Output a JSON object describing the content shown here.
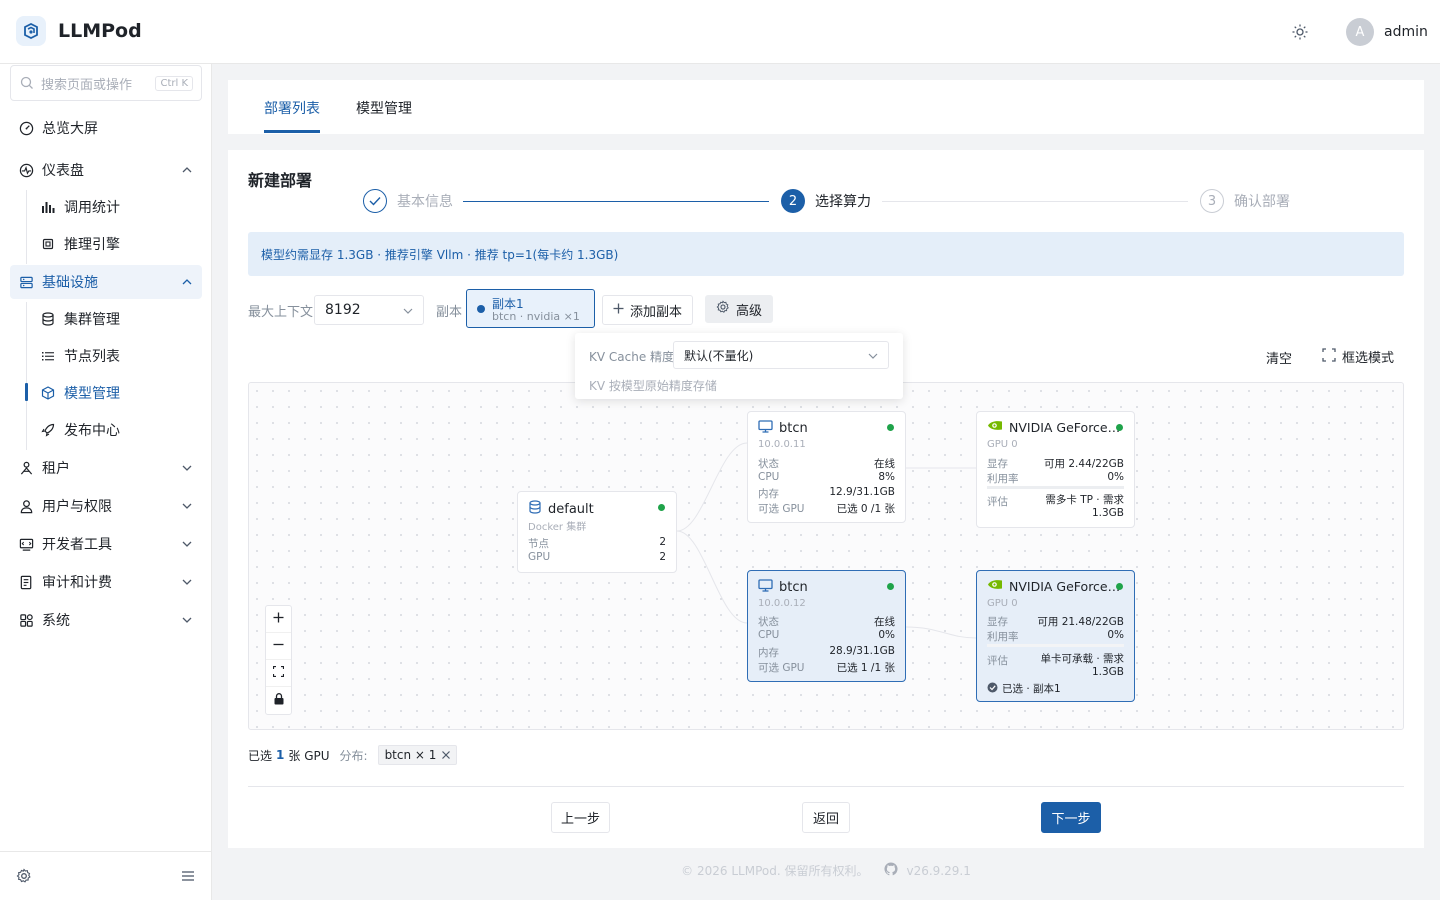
{
  "app": {
    "name": "LLMPod"
  },
  "user": {
    "avatar_letter": "A",
    "name": "admin"
  },
  "search": {
    "placeholder": "搜索页面或操作",
    "shortcut": "Ctrl K"
  },
  "sidebar": {
    "items": [
      {
        "label": "总览大屏",
        "icon": "dashboard-gauge-icon"
      },
      {
        "label": "仪表盘",
        "icon": "activity-icon",
        "expanded": true,
        "children": [
          {
            "label": "调用统计",
            "icon": "bar-chart-icon"
          },
          {
            "label": "推理引擎",
            "icon": "chip-icon"
          }
        ]
      },
      {
        "label": "基础设施",
        "icon": "server-icon",
        "expanded": true,
        "active": true,
        "children": [
          {
            "label": "集群管理",
            "icon": "database-icon"
          },
          {
            "label": "节点列表",
            "icon": "list-icon"
          },
          {
            "label": "模型管理",
            "icon": "cube-icon",
            "active": true
          },
          {
            "label": "发布中心",
            "icon": "rocket-icon"
          }
        ]
      },
      {
        "label": "租户",
        "icon": "tenant-icon"
      },
      {
        "label": "用户与权限",
        "icon": "user-icon"
      },
      {
        "label": "开发者工具",
        "icon": "dev-tools-icon"
      },
      {
        "label": "审计和计费",
        "icon": "receipt-icon"
      },
      {
        "label": "系统",
        "icon": "grid-icon"
      }
    ]
  },
  "tabs": [
    {
      "label": "部署列表",
      "active": true
    },
    {
      "label": "模型管理",
      "active": false
    }
  ],
  "page": {
    "title": "新建部署",
    "steps": [
      {
        "label": "基本信息",
        "state": "done"
      },
      {
        "label": "选择算力",
        "number": "2",
        "state": "current"
      },
      {
        "label": "确认部署",
        "number": "3",
        "state": "pending"
      }
    ],
    "info_banner": "模型约需显存 1.3GB · 推荐引擎 Vllm · 推荐 tp=1(每卡约 1.3GB)",
    "max_context_label": "最大上下文",
    "max_context_value": "8192",
    "replica_label": "副本",
    "replica": {
      "name": "副本1",
      "detail": "btcn · nvidia ×1"
    },
    "add_replica": "添加副本",
    "advanced": "高级",
    "popover": {
      "kv_label": "KV Cache 精度",
      "kv_value": "默认(不量化)",
      "kv_hint": "KV 按模型原始精度存储"
    },
    "clear": "清空",
    "box_select": "框选模式"
  },
  "topology": {
    "cluster": {
      "name": "default",
      "type": "Docker 集群",
      "rows": [
        {
          "k": "节点",
          "v": "2"
        },
        {
          "k": "GPU",
          "v": "2"
        }
      ]
    },
    "nodes": [
      {
        "name": "btcn",
        "ip": "10.0.0.11",
        "selected": false,
        "rows": [
          {
            "k": "状态",
            "v": "在线"
          },
          {
            "k": "CPU",
            "v": "8%"
          },
          {
            "k": "内存",
            "v": "12.9/31.1GB"
          },
          {
            "k": "可选 GPU",
            "v": "已选 0 /1 张"
          }
        ]
      },
      {
        "name": "btcn",
        "ip": "10.0.0.12",
        "selected": true,
        "rows": [
          {
            "k": "状态",
            "v": "在线"
          },
          {
            "k": "CPU",
            "v": "0%"
          },
          {
            "k": "内存",
            "v": "28.9/31.1GB"
          },
          {
            "k": "可选 GPU",
            "v": "已选 1 /1 张"
          }
        ]
      }
    ],
    "gpus": [
      {
        "name": "NVIDIA GeForce…",
        "index": "GPU 0",
        "selected": false,
        "rows": [
          {
            "k": "显存",
            "v": "可用 2.44/22GB"
          },
          {
            "k": "利用率",
            "v": "0%"
          }
        ],
        "eval_label": "评估",
        "eval_value": "需多卡 TP · 需求 1.3GB"
      },
      {
        "name": "NVIDIA GeForce…",
        "index": "GPU 0",
        "selected": true,
        "rows": [
          {
            "k": "显存",
            "v": "可用 21.48/22GB"
          },
          {
            "k": "利用率",
            "v": "0%"
          }
        ],
        "eval_label": "评估",
        "eval_value": "单卡可承载 · 需求 1.3GB",
        "selected_tag": "已选 · 副本1"
      }
    ]
  },
  "summary": {
    "prefix": "已选",
    "count": "1",
    "suffix": "张 GPU",
    "dist_label": "分布:",
    "dist_chip": "btcn × 1"
  },
  "buttons": {
    "prev": "上一步",
    "back": "返回",
    "next": "下一步"
  },
  "footer": {
    "copyright": "© 2026 LLMPod. 保留所有权利。",
    "version": "v26.9.29.1"
  },
  "colors": {
    "primary": "#1c5fa8",
    "online": "#1fa34a",
    "gpu_green": "#76b900"
  }
}
